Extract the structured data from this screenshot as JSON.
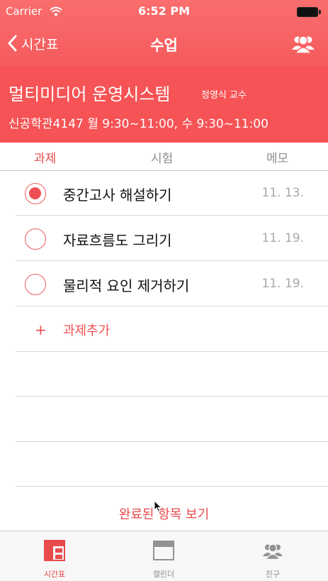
{
  "status": {
    "carrier": "Carrier",
    "time": "6:52 PM"
  },
  "nav": {
    "back_label": "시간표",
    "title": "수업"
  },
  "course": {
    "name": "멀티미디어 운영시스템",
    "professor": "정영식 교수",
    "info": "신공학관4147   월 9:30~11:00, 수 9:30~11:00"
  },
  "tabs": [
    {
      "label": "과제",
      "active": true
    },
    {
      "label": "시험",
      "active": false
    },
    {
      "label": "메모",
      "active": false
    }
  ],
  "tasks": [
    {
      "title": "중간고사 해설하기",
      "date": "11. 13.",
      "checked": true
    },
    {
      "title": "자료흐름도 그리기",
      "date": "11. 19.",
      "checked": false
    },
    {
      "title": "물리적 요인 제거하기",
      "date": "11. 19.",
      "checked": false
    }
  ],
  "add_task": {
    "plus": "+",
    "label": "과제추가"
  },
  "show_completed": "완료된 항목 보기",
  "tabbar": [
    {
      "label": "시간표",
      "icon": "timetable-icon",
      "active": true
    },
    {
      "label": "캘린더",
      "icon": "calendar-icon",
      "active": false
    },
    {
      "label": "친구",
      "icon": "friends-icon",
      "active": false
    }
  ],
  "colors": {
    "accent": "#f55355",
    "accent_text": "#e94a4c",
    "inactive": "#929292"
  }
}
